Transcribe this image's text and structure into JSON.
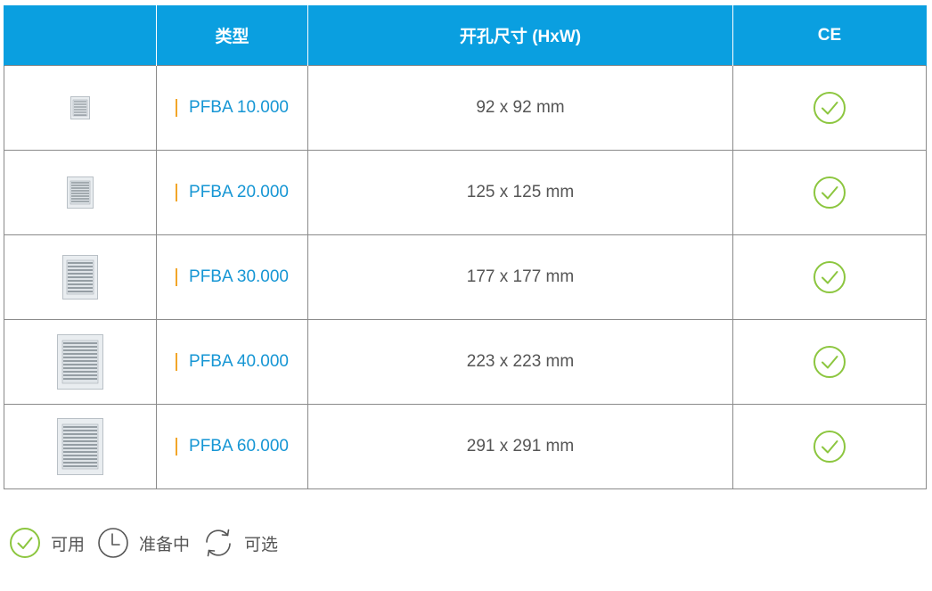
{
  "table": {
    "headers": {
      "type": "类型",
      "size": "开孔尺寸 (HxW)",
      "ce": "CE"
    },
    "rows": [
      {
        "type": "PFBA 10.000",
        "size": "92 x 92 mm",
        "ce_icon": "check-circle-icon"
      },
      {
        "type": "PFBA 20.000",
        "size": "125 x 125 mm",
        "ce_icon": "check-circle-icon"
      },
      {
        "type": "PFBA 30.000",
        "size": "177 x 177 mm",
        "ce_icon": "check-circle-icon"
      },
      {
        "type": "PFBA 40.000",
        "size": "223 x 223 mm",
        "ce_icon": "check-circle-icon"
      },
      {
        "type": "PFBA 60.000",
        "size": "291 x 291 mm",
        "ce_icon": "check-circle-icon"
      }
    ]
  },
  "legend": {
    "available": {
      "icon": "check-circle-icon",
      "label": "可用"
    },
    "in_preparation": {
      "icon": "clock-icon",
      "label": "准备中"
    },
    "optional": {
      "icon": "refresh-icon",
      "label": "可选"
    }
  },
  "colors": {
    "header_bg": "#0a9fe0",
    "link": "#1696d4",
    "accent_bar": "#f2a629",
    "check_green": "#8cc63f",
    "border": "#8a8a8a"
  }
}
